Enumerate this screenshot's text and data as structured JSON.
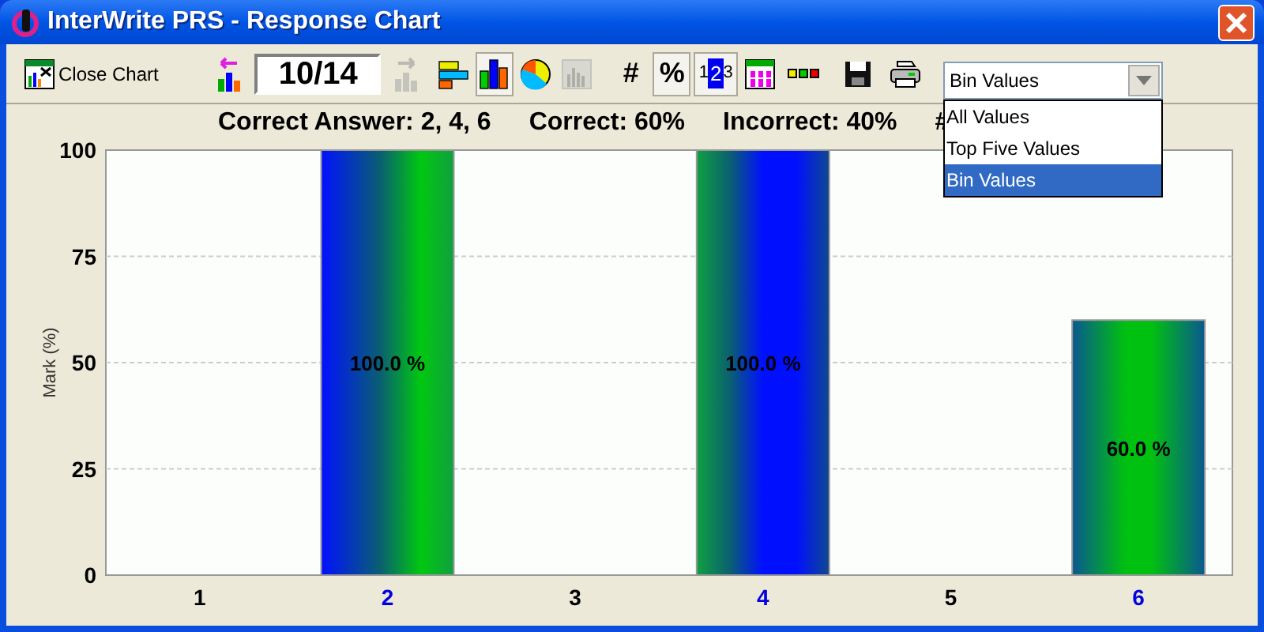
{
  "window": {
    "title": "InterWrite PRS - Response Chart"
  },
  "toolbar": [
    {
      "kind": "button",
      "label": "Close Chart",
      "pressed": false,
      "disabled": false
    },
    {
      "kind": "icon",
      "pressed": false,
      "disabled": false
    },
    {
      "kind": "field",
      "value": "10/14"
    },
    {
      "kind": "icon",
      "pressed": false,
      "disabled": true
    },
    {
      "kind": "icon",
      "pressed": false,
      "disabled": false
    },
    {
      "kind": "icon",
      "pressed": true,
      "disabled": false
    },
    {
      "kind": "icon",
      "pressed": false,
      "disabled": false
    },
    {
      "kind": "icon",
      "pressed": false,
      "disabled": true
    },
    {
      "kind": "text",
      "label": "#",
      "pressed": false,
      "disabled": false
    },
    {
      "kind": "text",
      "label": "%",
      "pressed": true,
      "disabled": false
    },
    {
      "kind": "digits",
      "label": "123",
      "pressed": true,
      "disabled": false
    },
    {
      "kind": "icon",
      "pressed": false,
      "disabled": false
    },
    {
      "kind": "icon",
      "pressed": false,
      "disabled": false
    },
    {
      "kind": "icon",
      "pressed": false,
      "disabled": false
    },
    {
      "kind": "icon",
      "pressed": false,
      "disabled": false
    }
  ],
  "view_dropdown": {
    "value": "Bin Values",
    "expanded": true,
    "options": [
      {
        "label": "All Values",
        "selected": false
      },
      {
        "label": "Top Five Values",
        "selected": false
      },
      {
        "label": "Bin Values",
        "selected": true
      }
    ]
  },
  "summary": [
    "Correct Answer: 2, 4, 6",
    "Correct: 60%",
    "Incorrect: 40%",
    "#"
  ],
  "chart": {
    "category_correct": [
      false,
      true,
      false,
      true,
      false,
      true
    ],
    "chart_data": {
      "type": "bar",
      "ylabel": "Mark (%)",
      "categories": [
        "1",
        "2",
        "3",
        "4",
        "5",
        "6"
      ],
      "values": [
        0,
        100,
        0,
        100,
        0,
        60
      ],
      "ylim": [
        0,
        100
      ],
      "yticks": [
        0,
        25,
        50,
        75,
        100
      ],
      "grid": true,
      "value_labels": [
        null,
        "100.0 %",
        null,
        "100.0 %",
        null,
        "60.0 %"
      ]
    }
  }
}
